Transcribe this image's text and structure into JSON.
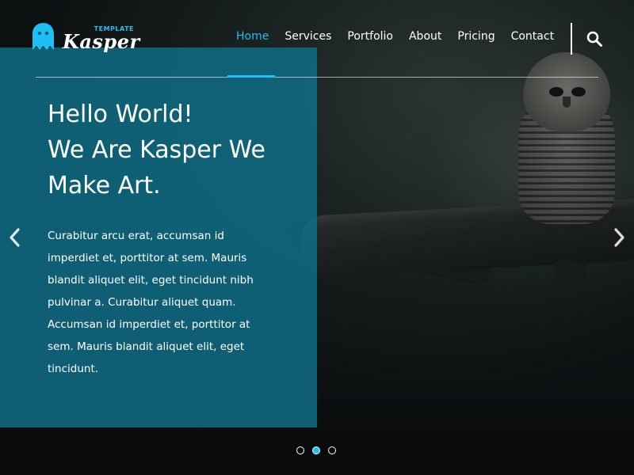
{
  "brand": {
    "tag": "TEMPLATE",
    "name": "Kasper",
    "accent_color": "#1ec0f3"
  },
  "nav": {
    "items": [
      {
        "label": "Home",
        "active": true
      },
      {
        "label": "Services",
        "active": false
      },
      {
        "label": "Portfolio",
        "active": false
      },
      {
        "label": "About",
        "active": false
      },
      {
        "label": "Pricing",
        "active": false
      },
      {
        "label": "Contact",
        "active": false
      }
    ],
    "search_icon": "search-icon"
  },
  "hero": {
    "title_lines": [
      "Hello World!",
      "We Are Kasper We",
      "Make Art."
    ],
    "text_lines": [
      "Curabitur arcu erat, accumsan id",
      "imperdiet et, porttitor at sem. Mauris",
      "blandit aliquet elit, eget tincidunt nibh",
      "pulvinar a. Curabitur aliquet quam.",
      "Accumsan id imperdiet et, porttitor at",
      "sem. Mauris blandit aliquet elit, eget",
      "tincidunt."
    ],
    "box_color": "#10708a"
  },
  "slider": {
    "prev_icon": "chevron-left-icon",
    "next_icon": "chevron-right-icon",
    "bullets_count": 3,
    "active_bullet": 2
  }
}
